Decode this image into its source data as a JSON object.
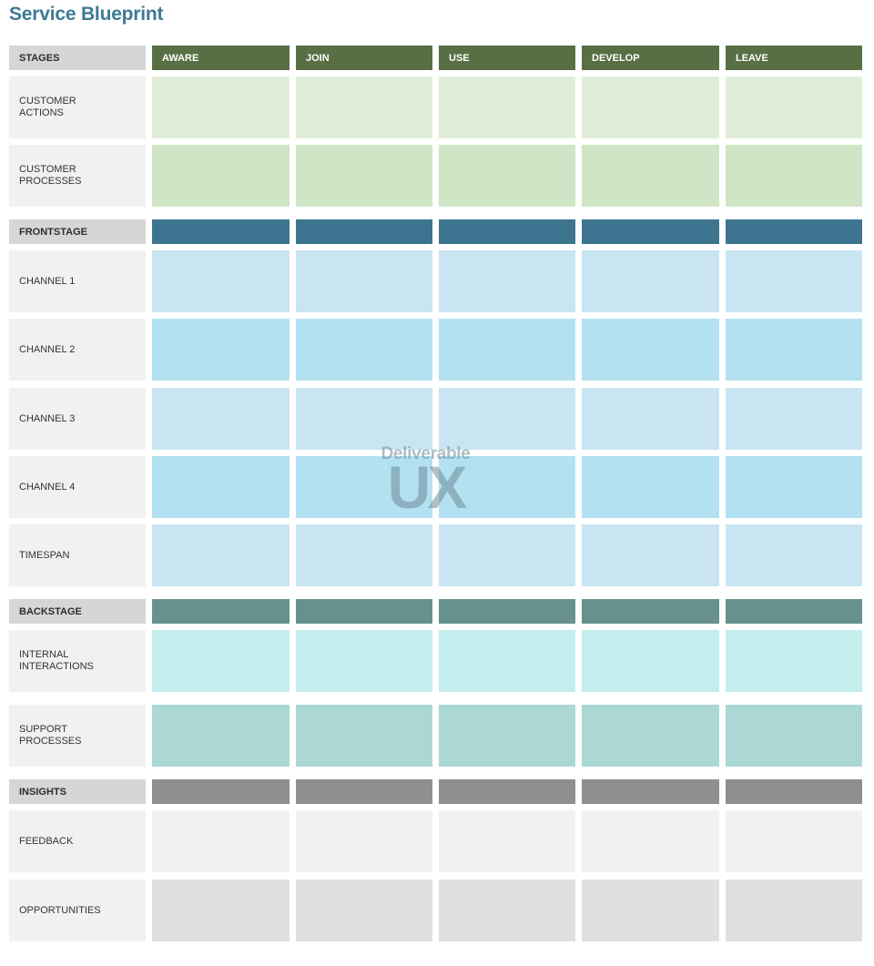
{
  "title": "Service Blueprint",
  "stages_label": "STAGES",
  "stages": [
    "AWARE",
    "JOIN",
    "USE",
    "DEVELOP",
    "LEAVE"
  ],
  "watermark": {
    "top": "Deliverable",
    "main": "UX"
  },
  "colors": {
    "stage_header": "#586f44",
    "frontstage_header": "#3d7590",
    "backstage_header": "#67918f",
    "insights_header": "#8f8f8f",
    "customer_actions": "#e0eed9",
    "customer_processes": "#cfe5c5",
    "channel_light": "#c9e5f1",
    "channel_dark": "#b4e1f1",
    "internal_interactions": "#c3eeed",
    "support_processes": "#abd8d5",
    "feedback": "#f1f1f1",
    "opportunities": "#e0e0e0",
    "label_bg": "#f1f1f1",
    "section_label_bg": "#d6d6d6"
  },
  "rows": [
    {
      "kind": "stage-header",
      "label": "STAGES",
      "color": "#586f44"
    },
    {
      "kind": "row",
      "label": "CUSTOMER\nACTIONS",
      "color": "#e0eed9"
    },
    {
      "kind": "row",
      "label": "CUSTOMER\nPROCESSES",
      "color": "#cfe5c5"
    },
    {
      "kind": "section",
      "label": "FRONTSTAGE",
      "color": "#3d7590"
    },
    {
      "kind": "row",
      "label": "CHANNEL 1",
      "color": "#c9e5f1"
    },
    {
      "kind": "row",
      "label": "CHANNEL 2",
      "color": "#b4e1f1"
    },
    {
      "kind": "row",
      "label": "CHANNEL 3",
      "color": "#c9e5f1"
    },
    {
      "kind": "row",
      "label": "CHANNEL 4",
      "color": "#b4e1f1"
    },
    {
      "kind": "row",
      "label": "TIMESPAN",
      "color": "#c9e5f1"
    },
    {
      "kind": "section",
      "label": "BACKSTAGE",
      "color": "#67918f"
    },
    {
      "kind": "row",
      "label": "INTERNAL\nINTERACTIONS",
      "color": "#c3eeed"
    },
    {
      "kind": "row",
      "label": "SUPPORT\nPROCESSES",
      "color": "#abd8d5"
    },
    {
      "kind": "section",
      "label": "INSIGHTS",
      "color": "#8f8f8f"
    },
    {
      "kind": "row",
      "label": "FEEDBACK",
      "color": "#f1f1f1"
    },
    {
      "kind": "row",
      "label": "OPPORTUNITIES",
      "color": "#e0e0e0"
    }
  ]
}
